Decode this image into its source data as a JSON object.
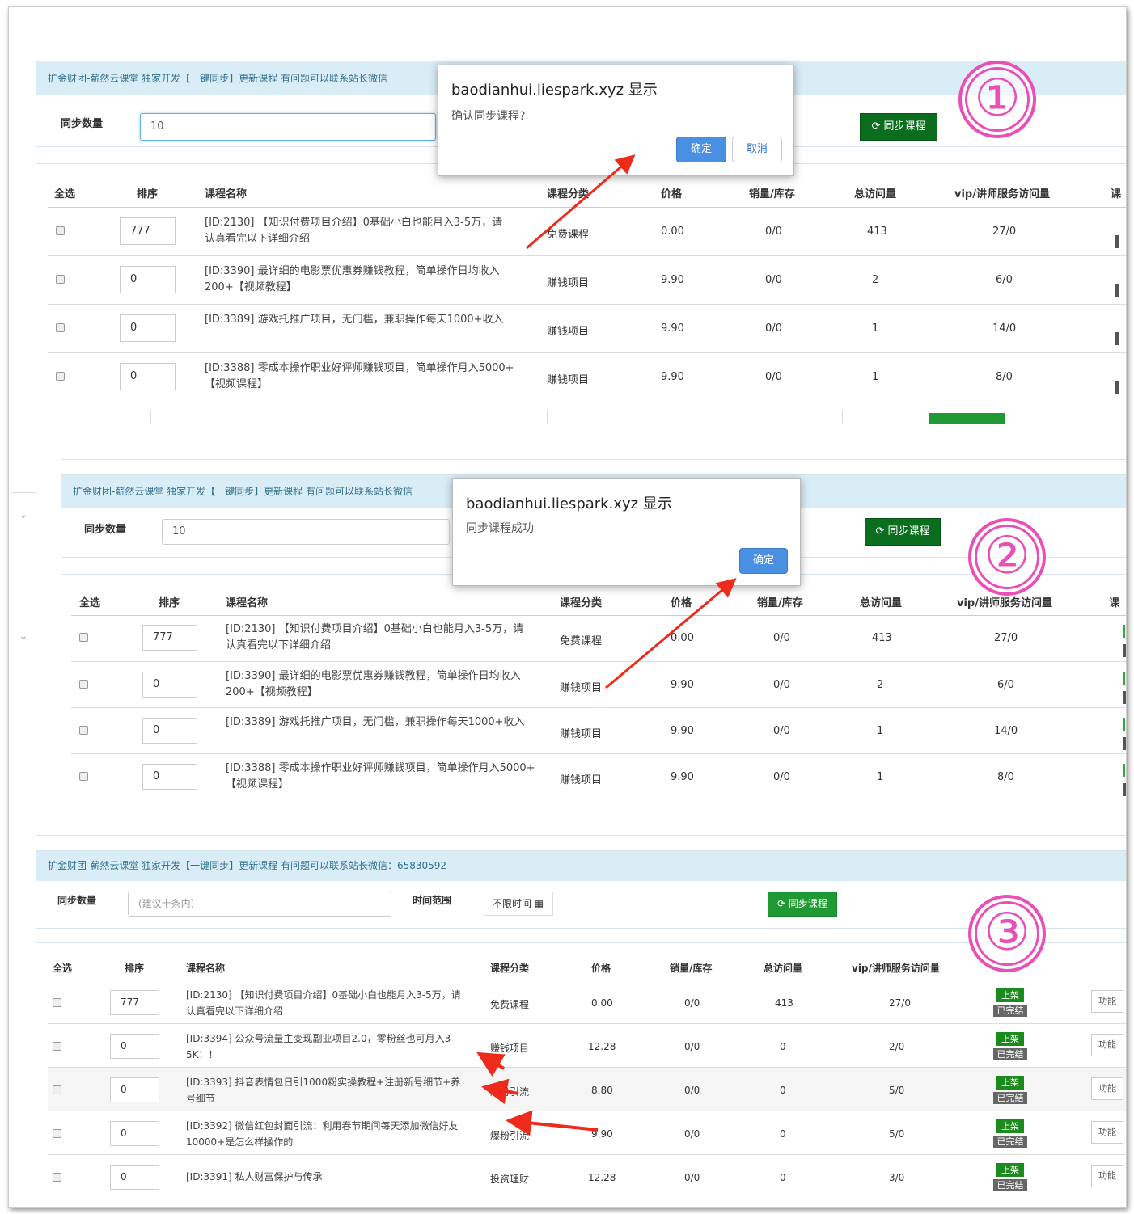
{
  "banner_text": "扩金财团-薪然云课堂 独家开发【一键同步】更新课程 有问题可以联系站长微信",
  "banner_text_full": "扩金财团-薪然云课堂 独家开发【一键同步】更新课程 有问题可以联系站长微信：65830592",
  "sync_label": "同步数量",
  "sync_value": "10",
  "sync_placeholder": "(建议十条内)",
  "time_label": "时间范围",
  "time_value": "不限时间",
  "sync_button": "同步课程",
  "headers": {
    "select_all": "全选",
    "sort": "排序",
    "name": "课程名称",
    "category": "课程分类",
    "price": "价格",
    "sales": "销量/库存",
    "visits": "总访问量",
    "vip": "vip/讲师服务访问量",
    "cut": "课"
  },
  "dialog1": {
    "title": "baodianhui.liespark.xyz 显示",
    "message": "确认同步课程?",
    "ok": "确定",
    "cancel": "取消"
  },
  "dialog2": {
    "title": "baodianhui.liespark.xyz 显示",
    "message": "同步课程成功",
    "ok": "确定"
  },
  "markers": [
    "①",
    "②",
    "③"
  ],
  "rows_a": [
    {
      "sort": "777",
      "name": "[ID:2130] 【知识付费项目介绍】0基础小白也能月入3-5万，请认真看完以下详细介绍",
      "category": "免费课程",
      "price": "0.00",
      "sales": "0/0",
      "visits": "413",
      "vip": "27/0"
    },
    {
      "sort": "0",
      "name": "[ID:3390] 最详细的电影票优惠券赚钱教程，简单操作日均收入200+【视频教程】",
      "category": "赚钱项目",
      "price": "9.90",
      "sales": "0/0",
      "visits": "2",
      "vip": "6/0"
    },
    {
      "sort": "0",
      "name": "[ID:3389] 游戏托推广项目，无门槛，兼职操作每天1000+收入",
      "category": "赚钱项目",
      "price": "9.90",
      "sales": "0/0",
      "visits": "1",
      "vip": "14/0"
    },
    {
      "sort": "0",
      "name": "[ID:3388] 零成本操作职业好评师赚钱项目，简单操作月入5000+【视频课程】",
      "category": "赚钱项目",
      "price": "9.90",
      "sales": "0/0",
      "visits": "1",
      "vip": "8/0"
    }
  ],
  "rows_c": [
    {
      "sort": "777",
      "name": "[ID:2130] 【知识付费项目介绍】0基础小白也能月入3-5万，请认真看完以下详细介绍",
      "category": "免费课程",
      "price": "0.00",
      "sales": "0/0",
      "visits": "413",
      "vip": "27/0"
    },
    {
      "sort": "0",
      "name": "[ID:3394] 公众号流量主变现副业项目2.0，零粉丝也可月入3-5K！！",
      "category": "赚钱项目",
      "price": "12.28",
      "sales": "0/0",
      "visits": "0",
      "vip": "2/0"
    },
    {
      "sort": "0",
      "name": "[ID:3393] 抖音表情包日引1000粉实操教程+注册新号细节+养号细节",
      "category": "爆粉引流",
      "price": "8.80",
      "sales": "0/0",
      "visits": "0",
      "vip": "5/0"
    },
    {
      "sort": "0",
      "name": "[ID:3392] 微信红包封面引流：利用春节期间每天添加微信好友10000+是怎么样操作的",
      "category": "爆粉引流",
      "price": "9.90",
      "sales": "0/0",
      "visits": "0",
      "vip": "5/0"
    },
    {
      "sort": "0",
      "name": "[ID:3391] 私人财富保护与传承",
      "category": "投资理财",
      "price": "12.28",
      "sales": "0/0",
      "visits": "0",
      "vip": "3/0"
    }
  ],
  "status_on": "上架",
  "status_done": "已完结",
  "func_label": "功能",
  "colors": {
    "accent": "#0b6e1f",
    "header_bg": "#d9edf7",
    "marker": "#e94fb6",
    "arrow": "#ee2a1b",
    "ok_btn": "#4a90e2"
  }
}
